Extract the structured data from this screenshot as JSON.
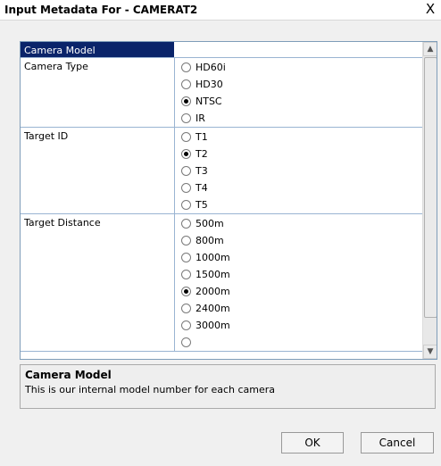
{
  "window": {
    "title": "Input Metadata For - CAMERAT2",
    "close_glyph": "X"
  },
  "grid": {
    "header_label": "Camera Model",
    "header_value": "",
    "rows": [
      {
        "label": "Camera Type",
        "options": [
          {
            "label": "HD60i",
            "checked": false
          },
          {
            "label": "HD30",
            "checked": false
          },
          {
            "label": "NTSC",
            "checked": true
          },
          {
            "label": "IR",
            "checked": false
          }
        ]
      },
      {
        "label": "Target ID",
        "options": [
          {
            "label": "T1",
            "checked": false
          },
          {
            "label": "T2",
            "checked": true
          },
          {
            "label": "T3",
            "checked": false
          },
          {
            "label": "T4",
            "checked": false
          },
          {
            "label": "T5",
            "checked": false
          }
        ]
      },
      {
        "label": "Target Distance",
        "options": [
          {
            "label": "500m",
            "checked": false
          },
          {
            "label": "800m",
            "checked": false
          },
          {
            "label": "1000m",
            "checked": false
          },
          {
            "label": "1500m",
            "checked": false
          },
          {
            "label": "2000m",
            "checked": true
          },
          {
            "label": "2400m",
            "checked": false
          },
          {
            "label": "3000m",
            "checked": false
          },
          {
            "label": "",
            "checked": false
          }
        ]
      }
    ]
  },
  "scrollbar": {
    "up_glyph": "▲",
    "down_glyph": "▼"
  },
  "description": {
    "title": "Camera Model",
    "text": "This is our internal model number for each camera"
  },
  "buttons": {
    "ok": "OK",
    "cancel": "Cancel"
  }
}
